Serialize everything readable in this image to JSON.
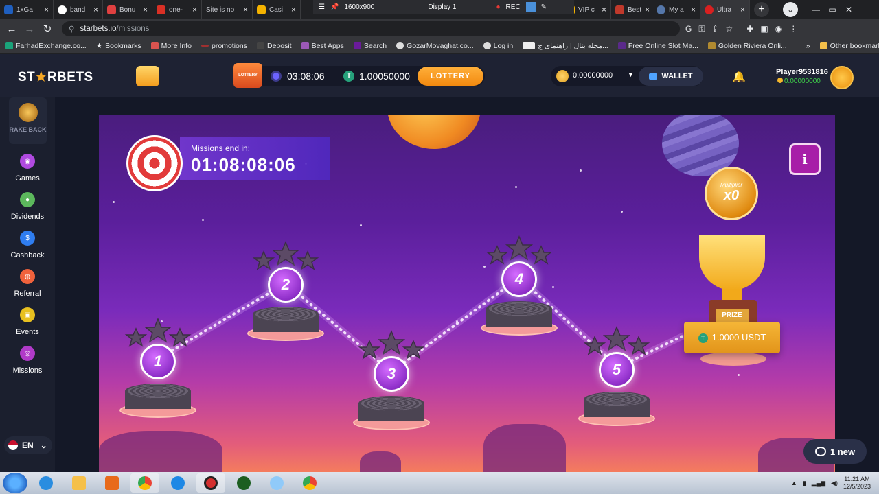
{
  "browser": {
    "tabs": [
      {
        "label": "1xGa",
        "color": "#1f5fbf"
      },
      {
        "label": "band",
        "color": "#ffffff"
      },
      {
        "label": "Bonu",
        "color": "#e04040"
      },
      {
        "label": "one-",
        "color": "#d93025"
      },
      {
        "label": "Site is no",
        "color": "#888888"
      },
      {
        "label": "Casi",
        "color": "#f5b300"
      },
      {
        "label": "VIP c",
        "color": "#f5b300"
      },
      {
        "label": "Best",
        "color": "#c0392b"
      },
      {
        "label": "My a",
        "color": "#5577aa"
      },
      {
        "label": "Ultra",
        "color": "#d92020"
      }
    ],
    "recording": {
      "resolution": "1600x900",
      "display": "Display 1",
      "rec": "REC"
    },
    "url_domain": "starbets.io",
    "url_path": "/missions",
    "bookmarks": [
      "FarhadExchange.co...",
      "Bookmarks",
      "More Info",
      "promotions",
      "Deposit",
      "Best Apps",
      "Search",
      "GozarMovaghat.co...",
      "Log in",
      "مجله بتال | راهنمای ج...",
      "Free Online Slot Ma...",
      "Golden Riviera Onli..."
    ],
    "more_bookmarks": "»",
    "other_bookmarks": "Other bookmarks"
  },
  "header": {
    "logo_prefix": "ST",
    "logo_star": "★",
    "logo_suffix": "RBETS",
    "lottery_ticket_label": "LOTTERY",
    "lottery_timer": "03:08:06",
    "lottery_amount": "1.00050000",
    "lottery_button": "LOTTERY",
    "wallet_balance": "0.00000000",
    "wallet_button": "WALLET",
    "player_name": "Player9531816",
    "player_balance": "0.00000000"
  },
  "sidebar": {
    "rakeback": "RAKE BACK",
    "items": [
      {
        "label": "Games",
        "color": "#b04ae0",
        "glyph": "◉"
      },
      {
        "label": "Dividends",
        "color": "#5cb85c",
        "glyph": "●"
      },
      {
        "label": "Cashback",
        "color": "#2f7df0",
        "glyph": "$"
      },
      {
        "label": "Referral",
        "color": "#f0623c",
        "glyph": "◍"
      },
      {
        "label": "Events",
        "color": "#e8c020",
        "glyph": "▣"
      },
      {
        "label": "Missions",
        "color": "#b03ac8",
        "glyph": "◎"
      }
    ],
    "language": "EN"
  },
  "missions": {
    "end_label": "Missions end in:",
    "end_value": "01:08:08:06",
    "info_button": "i",
    "multiplier_label": "Multiplier",
    "multiplier_value": "x0",
    "prize_label": "PRIZE",
    "prize_amount": "1.0000 USDT",
    "levels": [
      "1",
      "2",
      "3",
      "4",
      "5"
    ]
  },
  "chat": {
    "label": "1 new"
  },
  "taskbar": {
    "time": "11:21 AM",
    "date": "12/5/2023"
  }
}
